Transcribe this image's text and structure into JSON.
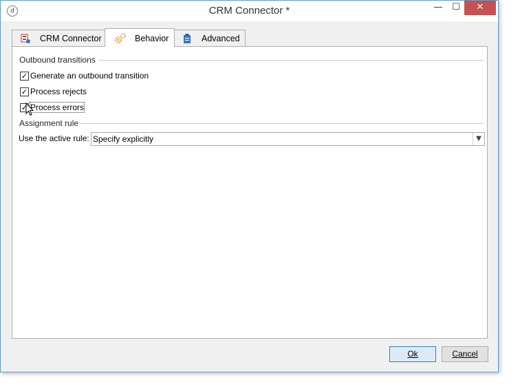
{
  "window": {
    "title": "CRM Connector *",
    "app_icon": "app-logo-icon"
  },
  "titlebar_buttons": {
    "minimize": "—",
    "maximize": "☐",
    "close": "✕"
  },
  "tabs": [
    {
      "label": "CRM Connector",
      "icon": "crm-connector-icon",
      "active": false
    },
    {
      "label": "Behavior",
      "icon": "gears-icon",
      "active": true
    },
    {
      "label": "Advanced",
      "icon": "clipboard-icon",
      "active": false
    }
  ],
  "outbound": {
    "heading": "Outbound transitions",
    "options": [
      {
        "label": "Generate an outbound transition",
        "checked": true
      },
      {
        "label": "Process rejects",
        "checked": true
      },
      {
        "label": "Process errors",
        "checked": true
      }
    ]
  },
  "assignment": {
    "heading": "Assignment rule",
    "label": "Use the active rule:",
    "value": "Specify explicitly"
  },
  "buttons": {
    "ok": "Ok",
    "cancel": "Cancel"
  },
  "colors": {
    "accent": "#3c7fb1",
    "close_button": "#c75050",
    "icon_orange": "#e8a33a",
    "icon_blue": "#3a78c2"
  }
}
